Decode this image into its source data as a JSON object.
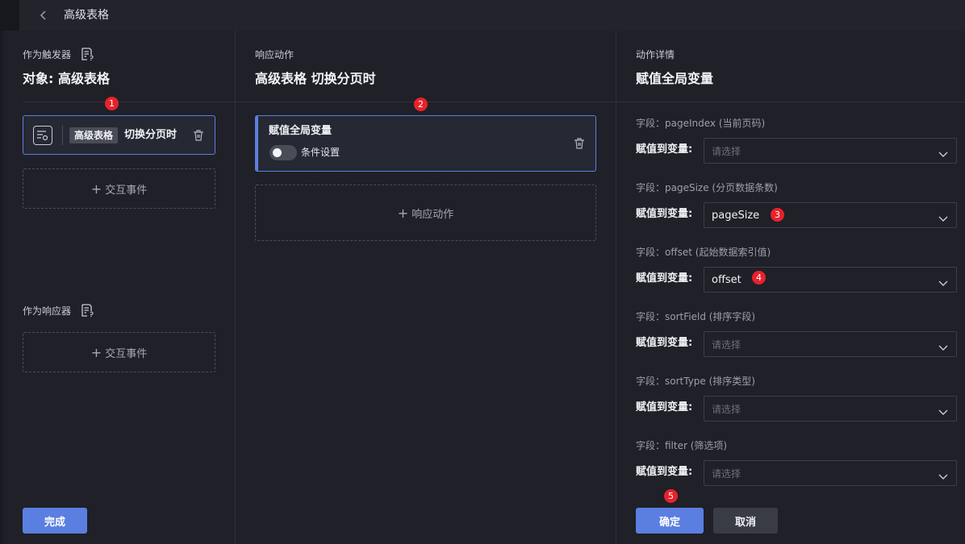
{
  "header": {
    "title": "高级表格"
  },
  "trigger_panel": {
    "section_label": "作为触发器",
    "object_title": "对象: 高级表格",
    "card": {
      "tag": "高级表格",
      "event": "切换分页时"
    },
    "add_event_label": "交互事件",
    "responder_label": "作为响应器",
    "add_event_label_2": "交互事件",
    "done_label": "完成"
  },
  "response_panel": {
    "section_label": "响应动作",
    "title": "高级表格 切换分页时",
    "card": {
      "title": "赋值全局变量",
      "toggle_label": "条件设置",
      "toggle_on": false
    },
    "add_action_label": "响应动作"
  },
  "detail_panel": {
    "section_label": "动作详情",
    "title": "赋值全局变量",
    "assign_label": "赋值到变量:",
    "placeholder": "请选择",
    "fields": [
      {
        "label": "字段：pageIndex (当前页码)",
        "value": ""
      },
      {
        "label": "字段：pageSize (分页数据条数)",
        "value": "pageSize"
      },
      {
        "label": "字段：offset (起始数据索引值)",
        "value": "offset"
      },
      {
        "label": "字段：sortField (排序字段)",
        "value": ""
      },
      {
        "label": "字段：sortType (排序类型)",
        "value": ""
      },
      {
        "label": "字段：filter (筛选项)",
        "value": ""
      }
    ],
    "confirm_label": "确定",
    "cancel_label": "取消"
  },
  "badges": [
    "1",
    "2",
    "3",
    "4",
    "5"
  ],
  "colors": {
    "accent": "#5b7fe0",
    "badge": "#e8222a",
    "background": "#1f2028"
  },
  "icons": [
    "back-arrow-icon",
    "doc-info-icon",
    "trigger-object-icon",
    "trash-icon",
    "plus-icon",
    "chevron-down-icon"
  ]
}
